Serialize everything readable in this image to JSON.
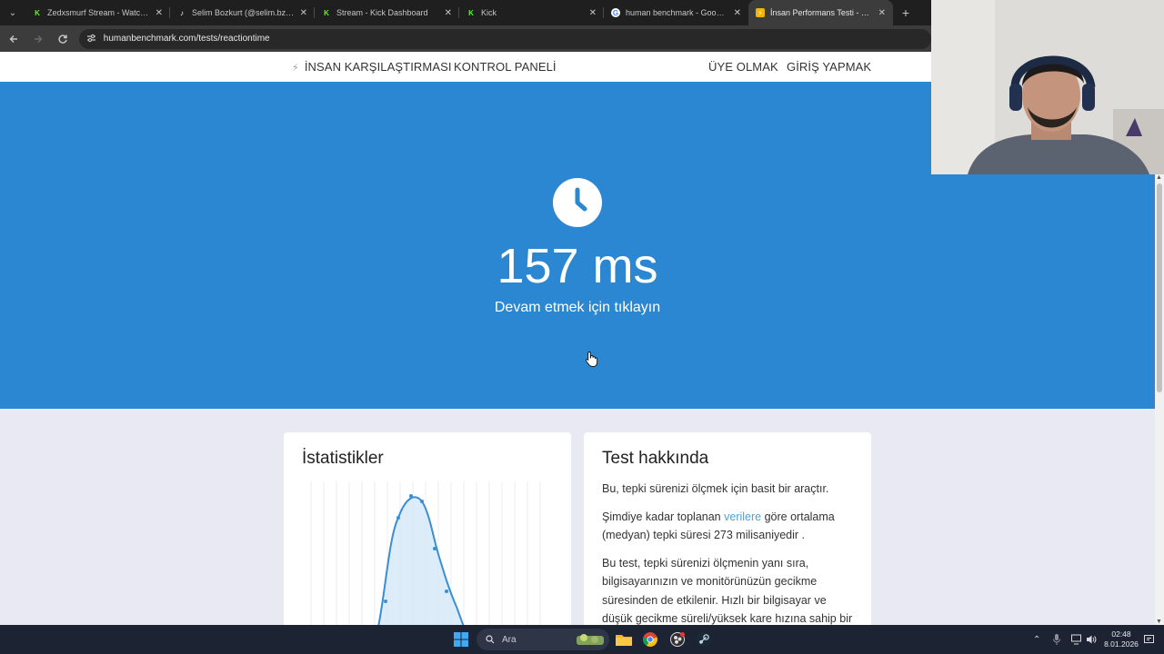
{
  "browser": {
    "tabs": [
      {
        "title": "Zedxsmurf Stream - Watch Live",
        "icon": "kick-icon",
        "active": false
      },
      {
        "title": "Selim Bozkurt (@selim.bzkurt) |",
        "icon": "tiktok-icon",
        "active": false
      },
      {
        "title": "Stream - Kick Dashboard",
        "icon": "kick-icon",
        "active": false
      },
      {
        "title": "Kick",
        "icon": "kick-icon",
        "active": false
      },
      {
        "title": "human benchmark - Google'da",
        "icon": "google-icon",
        "active": false
      },
      {
        "title": "İnsan Performans Testi - Tepki S",
        "icon": "humanbenchmark-icon",
        "active": true
      }
    ],
    "close_glyph": "✕",
    "new_tab_glyph": "+",
    "url": "humanbenchmark.com/tests/reactiontime"
  },
  "site_nav": {
    "brand": "İNSAN KARŞILAŞTIRMASI",
    "dashboard": "KONTROL PANELİ",
    "signup": "ÜYE OLMAK",
    "login": "GİRİŞ YAPMAK"
  },
  "hero": {
    "result": "157 ms",
    "subtitle": "Devam etmek için tıklayın",
    "background_color": "#2b87d1"
  },
  "stats_card": {
    "title": "İstatistikler"
  },
  "about_card": {
    "title": "Test hakkında",
    "p1": "Bu, tepki sürenizi ölçmek için basit bir araçtır.",
    "p2_before": "Şimdiye kadar toplanan",
    "p2_link": "verilere",
    "p2_after": "göre ortalama (medyan) tepki süresi 273 milisaniyedir .",
    "p3": "Bu test, tepki sürenizi ölçmenin yanı sıra, bilgisayarınızın ve monitörünüzün gecikme süresinden de etkilenir. Hızlı bir bilgisayar ve düşük gecikme süreli/yüksek kare hızına sahip bir monitör"
  },
  "taskbar": {
    "search_placeholder": "Ara",
    "time": "02:48",
    "date": "8.01.2026"
  }
}
